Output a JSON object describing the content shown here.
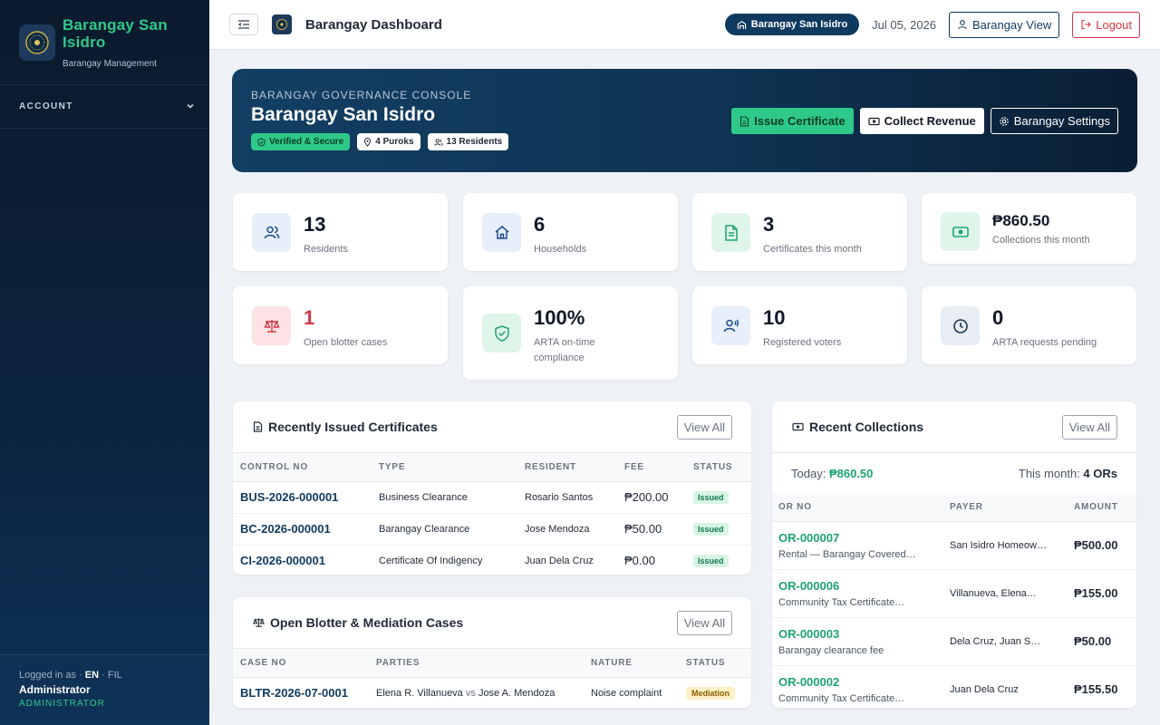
{
  "sidebar": {
    "brand_name": "Barangay San Isidro",
    "brand_sub": "Barangay Management",
    "section_account": "ACCOUNT",
    "footer": {
      "logged_in_as": "Logged in as",
      "lang_en": "EN",
      "lang_fil": "FIL",
      "user_name": "Administrator",
      "user_role": "ADMINISTRATOR"
    }
  },
  "topbar": {
    "title": "Barangay Dashboard",
    "barangay_pill": "Barangay San Isidro",
    "date": "Jul 05, 2026",
    "barangay_view": "Barangay View",
    "logout": "Logout"
  },
  "hero": {
    "kicker": "BARANGAY GOVERNANCE CONSOLE",
    "title": "Barangay San Isidro",
    "badges": [
      "Verified & Secure",
      "4 Puroks",
      "13 Residents"
    ],
    "actions": {
      "issue": "Issue Certificate",
      "collect": "Collect Revenue",
      "settings": "Barangay Settings"
    }
  },
  "stats": [
    {
      "value": "13",
      "label": "Residents",
      "icon": "users-icon"
    },
    {
      "value": "6",
      "label": "Households",
      "icon": "home-icon"
    },
    {
      "value": "3",
      "label": "Certificates this month",
      "icon": "document-icon"
    },
    {
      "value": "₱860.50",
      "label": "Collections this month",
      "icon": "cash-icon"
    },
    {
      "value": "1",
      "label": "Open blotter cases",
      "icon": "scales-icon"
    },
    {
      "value": "100%",
      "label": "ARTA on-time compliance",
      "icon": "shield-check-icon"
    },
    {
      "value": "10",
      "label": "Registered voters",
      "icon": "voter-icon"
    },
    {
      "value": "0",
      "label": "ARTA requests pending",
      "icon": "clock-icon"
    }
  ],
  "certificates": {
    "title": "Recently Issued Certificates",
    "view_all": "View All",
    "columns": [
      "CONTROL NO",
      "TYPE",
      "RESIDENT",
      "FEE",
      "STATUS"
    ],
    "rows": [
      {
        "control": "BUS-2026-000001",
        "type": "Business Clearance",
        "resident": "Rosario Santos",
        "fee": "₱200.00",
        "status": "Issued"
      },
      {
        "control": "BC-2026-000001",
        "type": "Barangay Clearance",
        "resident": "Jose Mendoza",
        "fee": "₱50.00",
        "status": "Issued"
      },
      {
        "control": "CI-2026-000001",
        "type": "Certificate Of Indigency",
        "resident": "Juan Dela Cruz",
        "fee": "₱0.00",
        "status": "Issued"
      }
    ]
  },
  "blotter": {
    "title": "Open Blotter & Mediation Cases",
    "view_all": "View All",
    "columns": [
      "CASE NO",
      "PARTIES",
      "NATURE",
      "STATUS"
    ],
    "rows": [
      {
        "case": "BLTR-2026-07-0001",
        "party_a": "Elena R. Villanueva",
        "vs": "vs",
        "party_b": "Jose A. Mendoza",
        "nature": "Noise complaint",
        "status": "Mediation"
      }
    ]
  },
  "collections": {
    "title": "Recent Collections",
    "view_all": "View All",
    "today_label": "Today:",
    "today_value": "₱860.50",
    "month_label": "This month:",
    "month_value": "4 ORs",
    "columns": [
      "OR NO",
      "PAYER",
      "AMOUNT"
    ],
    "rows": [
      {
        "or": "OR-000007",
        "desc": "Rental — Barangay Covered…",
        "payer": "San Isidro Homeow…",
        "amount": "₱500.00"
      },
      {
        "or": "OR-000006",
        "desc": "Community Tax Certificate…",
        "payer": "Villanueva, Elena…",
        "amount": "₱155.00"
      },
      {
        "or": "OR-000003",
        "desc": "Barangay clearance fee",
        "payer": "Dela Cruz, Juan S…",
        "amount": "₱50.00"
      },
      {
        "or": "OR-000002",
        "desc": "Community Tax Certificate…",
        "payer": "Juan Dela Cruz",
        "amount": "₱155.50"
      }
    ]
  }
}
